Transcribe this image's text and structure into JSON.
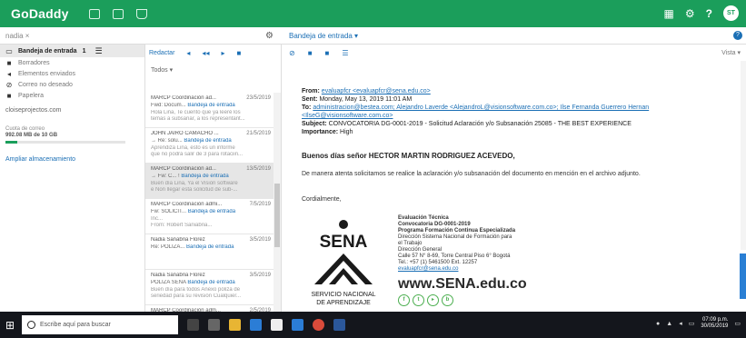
{
  "app": {
    "brand": "GoDaddy"
  },
  "search": {
    "value": "nadia ×"
  },
  "breadcrumb": {
    "folder": "Bandeja de entrada ▾"
  },
  "left": {
    "inbox_label": "Bandeja de entrada",
    "inbox_count": "1",
    "folders": [
      "Borradores",
      "Elementos enviados",
      "Correo no deseado",
      "Papelera"
    ],
    "domain": "cloiseprojectos.com",
    "storage_label": "Cuota de correo",
    "storage_value": "992.08 MB de 10 GB",
    "storage_fraction": 0.1,
    "expand_link": "Ampliar almacenamiento"
  },
  "list": {
    "compose_label": "Redactar",
    "filter_label": "Todos ▾",
    "messages": [
      {
        "sender": "MARCP Coordinación ad...",
        "date": "23/5/2019",
        "subject": "Fwd: Docum...",
        "tag": "Bandeja de entrada",
        "preview": "Hola Lina, Te cuento que ya leeré los",
        "preview2": "temas a subsanar, a los representant..."
      },
      {
        "sender": "JOHN JAIRO CAMACHO ...",
        "date": "21/5/2019",
        "subject": "→ Re: solu...",
        "tag": "Bandeja de entrada",
        "preview": "Aprendiza Lina, esto es un informe",
        "preview2": "que no podrá salir de 3 para rotaciin..."
      },
      {
        "sender": "MARCP Coordinación ad...",
        "date": "13/5/2019",
        "subject": "→ Fw: C... ! ",
        "tag": "Bandeja de entrada",
        "preview": "Buen día Lina, Ya el Visión software",
        "preview2": "e Non llegar esta solicitud de sub-..."
      },
      {
        "sender": "MARCP Coordinación admi...",
        "date": "7/5/2019",
        "subject": "Fw: SOLICIT...",
        "tag": "Bandeja de entrada",
        "preview": "Inc...",
        "preview2": "From: Robert Saniabria..."
      },
      {
        "sender": "Nadia Sanabria Florez",
        "date": "3/5/2019",
        "subject": "Re: POLIZA...",
        "tag": "Bandeja de entrada",
        "preview": "",
        "preview2": ""
      },
      {
        "sender": "Nadia Sanabria Florez",
        "date": "3/5/2019",
        "subject": "POLIZA SENA",
        "tag": "Bandeja de entrada",
        "preview": "Buen día para todos Anexo póliza de",
        "preview2": "seriedad para su revisión Cualquier..."
      },
      {
        "sender": "MARCP Coordinación adm...",
        "date": "2/5/2019",
        "subject": "",
        "tag": "",
        "preview": "",
        "preview2": ""
      }
    ]
  },
  "reader": {
    "view_label": "Vista ▾",
    "from_label": "From:",
    "from_value": "evaluapfcr <evaluapfcr@sena.edu.co>",
    "sent_label": "Sent:",
    "sent_value": "Monday, May 13, 2019 11:01 AM",
    "to_label": "To:",
    "to_value": "administracion@bestea.com; Alejandro Laverde <AlejandroL@visionsoftware.com.co>; Ilse Fernanda Guerrero Hernan <IlseG@visionsoftware.com.co>",
    "subject_label": "Subject:",
    "subject_value": "CONVOCATORIA DG-0001-2019 - Solicitud Aclaración y/o Subsanación 25085 - THE BEST EXPERIENCE",
    "importance_label": "Importance:",
    "importance_value": "High",
    "greeting": "Buenos días señor HECTOR MARTIN RODRIGUEZ ACEVEDO,",
    "body": "De manera atenta solicitamos se realice la aclaración y/o subsanación del documento en mención en el archivo adjunto.",
    "closing": "Cordialmente,",
    "logo": {
      "word": "SENA",
      "line1": "SERVICIO NACIONAL",
      "line2": "DE APRENDIZAJE"
    },
    "signature": {
      "title": "Evaluación Técnica",
      "conv": "Convocatoria DG-0001-2019",
      "program": "Programa Formación Continua Especializada",
      "org1": "Dirección Sistema Nacional de Formación para",
      "org2": "el Trabajo",
      "general": "Dirección General",
      "address": "Calle 57 N° 8-69, Torre Central Piso 6° Bogotá",
      "phone": "Tel.: +57 (1) 5461500 Ext. 12257",
      "email": "evaluapfcr@sena.edu.co",
      "site": "www.SENA.edu.co"
    }
  },
  "taskbar": {
    "search_placeholder": "Escribe aquí para buscar",
    "time": "07:09 p.m.",
    "date": "30/05/2019"
  },
  "colors": {
    "brand_green": "#1b9e5b",
    "link_blue": "#1b6fb5",
    "taskbar": "#14161c"
  }
}
